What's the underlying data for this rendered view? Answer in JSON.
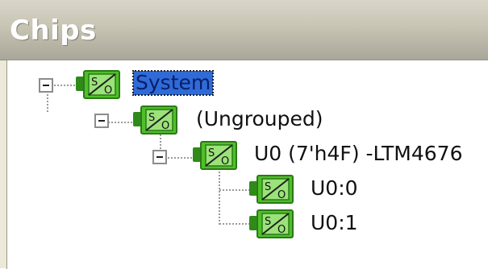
{
  "panel": {
    "title": "Chips"
  },
  "tree": {
    "root": {
      "label": "System",
      "selected": true,
      "expanded": true,
      "icon": "chip-s-o-icon"
    },
    "group": {
      "label": "(Ungrouped)",
      "expanded": true,
      "icon": "chip-s-o-icon"
    },
    "device": {
      "label": "U0 (7'h4F) -LTM4676",
      "expanded": true,
      "icon": "chip-s-o-icon"
    },
    "channels": [
      {
        "label": "U0:0",
        "icon": "chip-s-o-icon"
      },
      {
        "label": "U0:1",
        "icon": "chip-s-o-icon"
      }
    ]
  },
  "colors": {
    "selection": "#2f6bd8",
    "icon_green": "#4fbf2a",
    "title_text": "#ffffff"
  }
}
